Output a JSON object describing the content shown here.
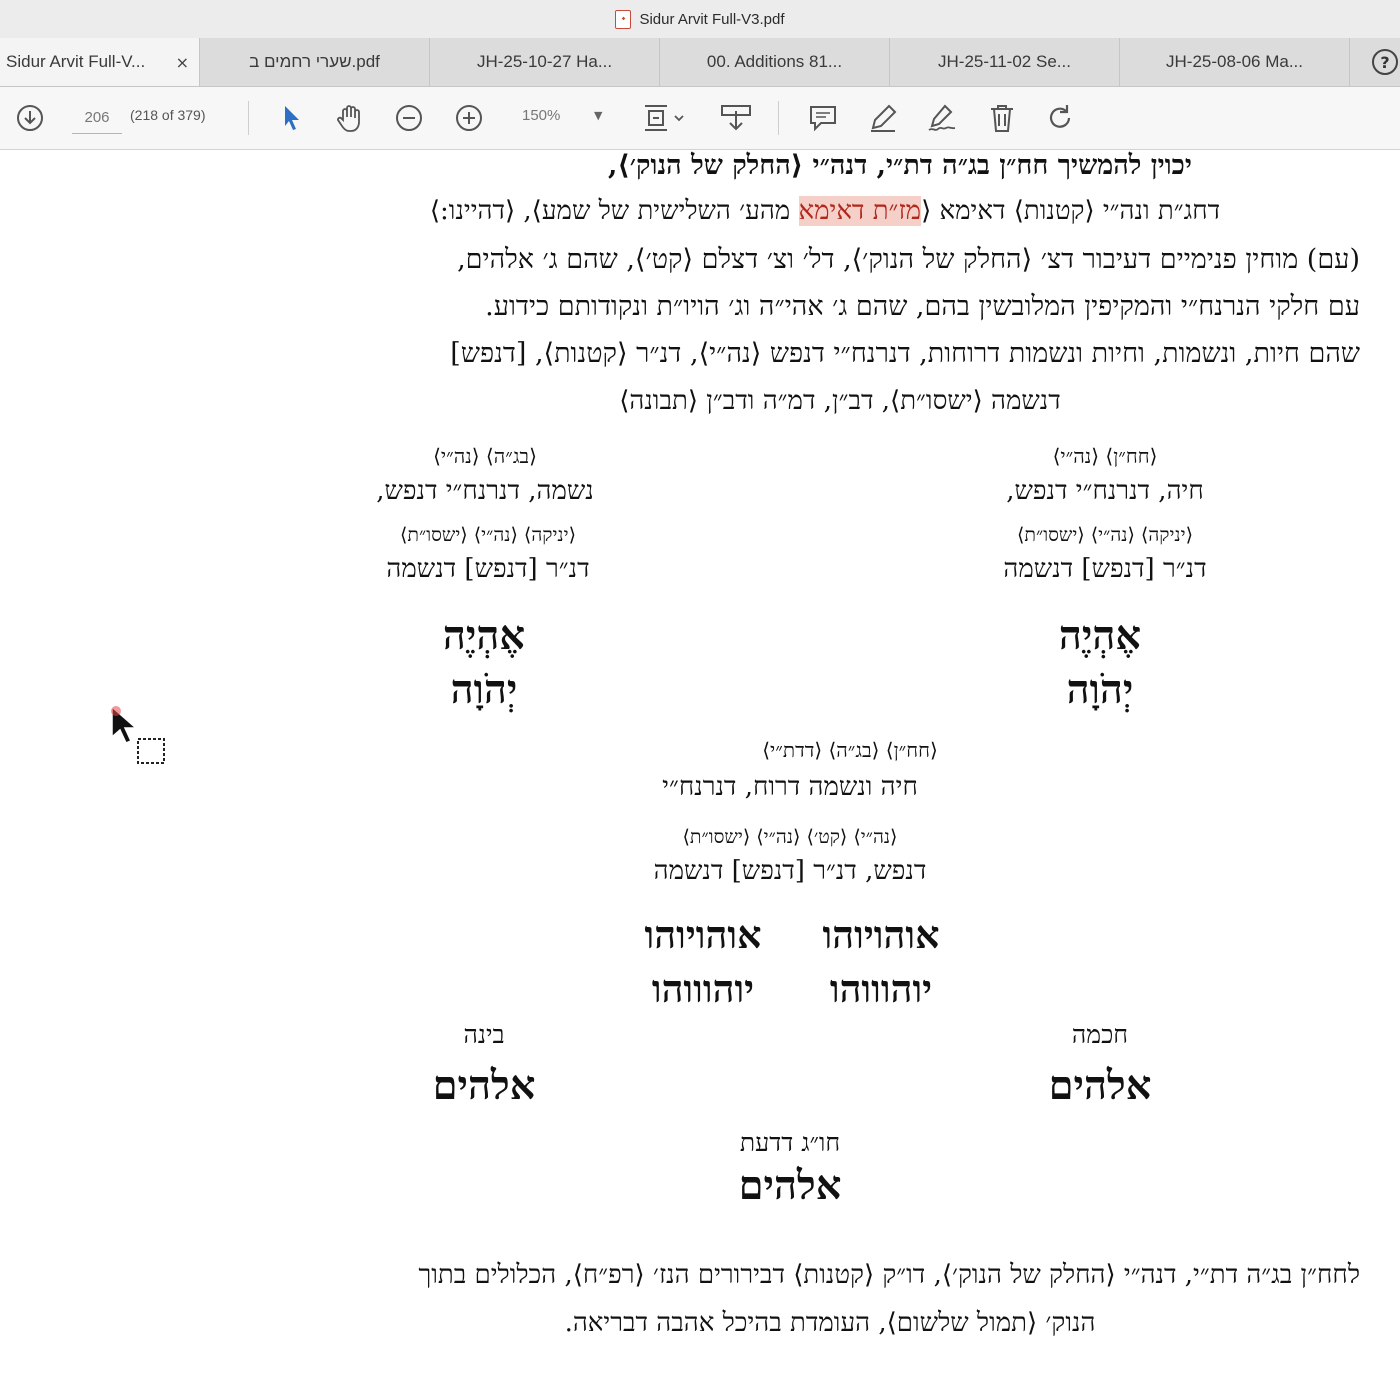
{
  "window": {
    "title": "Sidur Arvit Full-V3.pdf",
    "file_icon": "pdf-file-icon"
  },
  "tabs": [
    {
      "label": "Sidur Arvit Full-V...",
      "close": "×"
    },
    {
      "label": "שערי רחמים ב.pdf"
    },
    {
      "label": "JH-25-10-27 Ha..."
    },
    {
      "label": "00. Additions 81..."
    },
    {
      "label": "JH-25-11-02 Se..."
    },
    {
      "label": "JH-25-08-06 Ma..."
    }
  ],
  "help": "?",
  "toolbar": {
    "page_number": "206",
    "page_count": "(218 of 379)",
    "zoom": "150%",
    "icons": [
      "download-icon",
      "select-arrow-icon",
      "hand-icon",
      "zoom-out-icon",
      "zoom-in-icon",
      "fit-page-icon",
      "export-icon",
      "comment-icon",
      "highlight-pen-icon",
      "sign-icon",
      "trash-icon",
      "rotate-icon"
    ]
  },
  "doc": {
    "l1": "יכוין להמשיך חח״ן בג״ה דת״י, דנה״י ⟨החלק של הנוק׳⟩,",
    "l2a": "דחג״ת ונה״י ⟨קטנות⟩ דאימא ⟨",
    "l2hl": "מז״ת דאימא",
    "l2b": " מהע׳ השלישית של שמע⟩, ⟨דהיינו:⟩",
    "l3": "(עם) מוחין פנימיים דעיבור דצ׳ ⟨החלק של הנוק׳⟩, דל׳ וצ׳ דצלם ⟨קט׳⟩, שהם ג׳ אלהים,",
    "l4": "עם חלקי הנרנח״י והמקיפין המלובשין בהם, שהם ג׳ אהי״ה וג׳ הויו״ת ונקודותם כידוע.",
    "l5": "שהם חיות, ונשמות, וחיות ונשמות דרוחות, דנרנח״י דנפש ⟨נה״י⟩, דנ״ר ⟨קטנות⟩, [דנפש]",
    "l6": "דנשמה ⟨ישסו״ת⟩, דב״ן, דמ״ה ודב״ן ⟨תבונה⟩",
    "right_group": {
      "notes1": "⟨חח״ן⟩        ⟨נה״י⟩",
      "line1": "חיה, דנרנח״י דנפש,",
      "notes2": "⟨יניקה⟩  ⟨נה״י⟩  ⟨ישסו״ת⟩",
      "line2": "דנ״ר [דנפש] דנשמה",
      "name1": "אֶהְיֶה",
      "name2": "יְהֹוָה"
    },
    "left_group": {
      "notes1": "⟨בג״ה⟩          ⟨נה״י⟩",
      "line1": "נשמה, דנרנח״י דנפש,",
      "notes2": "⟨יניקה⟩  ⟨נה״י⟩  ⟨ישסו״ת⟩",
      "line2": "דנ״ר [דנפש] דנשמה",
      "name1": "אֶהְיֶה",
      "name2": "יְהֹוָה"
    },
    "center_group": {
      "notes1": "⟨חח״ן⟩ ⟨בג״ה⟩ ⟨דדת״י⟩",
      "line1": "חיה ונשמה דרוח, דנרנח״י",
      "notes2": "⟨נה״י⟩  ⟨קט׳⟩  ⟨נה״י⟩  ⟨ישסו״ת⟩",
      "line2": "דנפש, דנ״ר [דנפש] דנשמה",
      "name_r1": "אוהויוהו",
      "name_l1": "אוהויוהו",
      "name_r2": "יוהוווהו",
      "name_l2": "יוהוווהו"
    },
    "chochma_label": "חכמה",
    "chochma_name": "אלהים",
    "bina_label": "בינה",
    "bina_name": "אלהים",
    "daat_label": "חו״ג דדעת",
    "daat_name": "אלהים",
    "b1": "לחח״ן בג״ה דת״י, דנה״י ⟨החלק של הנוק׳⟩, דו״ק ⟨קטנות⟩ דבירורים הנז׳ ⟨רפ״ח⟩, הכלולים בתוך",
    "b2": "הנוק׳ ⟨תמול שלשום⟩, העומדת בהיכל אהבה דבריאה."
  }
}
